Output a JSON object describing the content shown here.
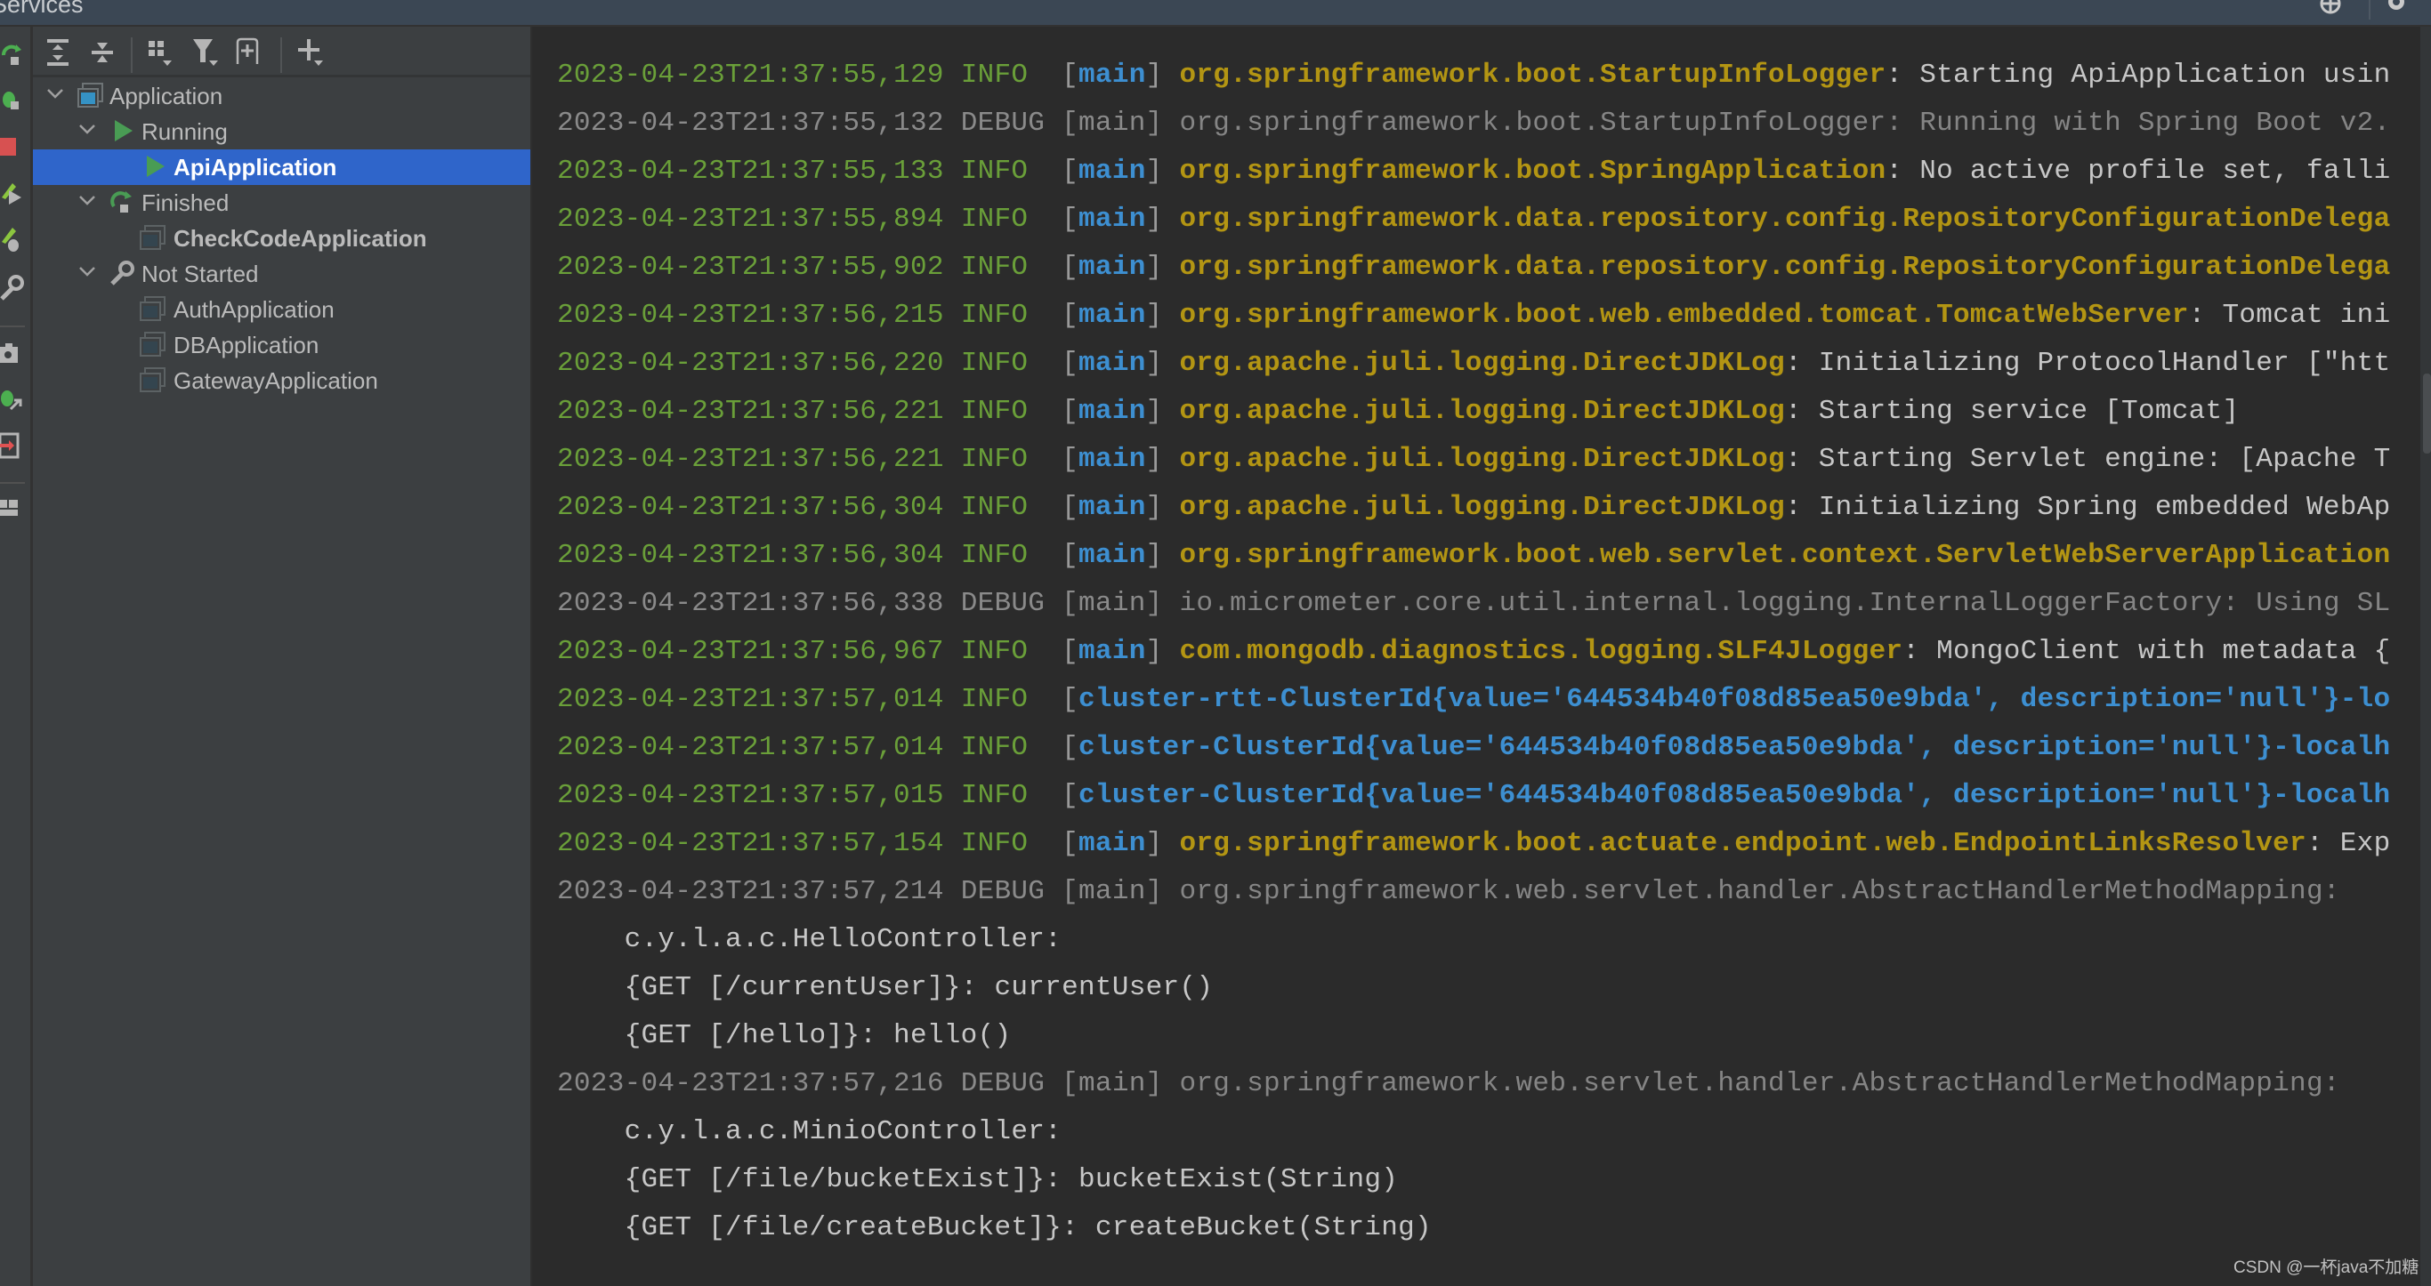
{
  "window": {
    "title": "Services"
  },
  "header_icons": [
    "globe-icon",
    "gear-icon"
  ],
  "left_strip_icons": [
    "rerun-icon",
    "debug-rerun-icon",
    "stop-icon",
    "run-boot-icon",
    "debug-boot-icon",
    "wrench-icon",
    "camera-icon",
    "attach-debugger-icon",
    "exit-icon",
    "layout-icon"
  ],
  "toolbar": {
    "buttons": [
      {
        "name": "expand-all-icon",
        "tooltip": "Expand All"
      },
      {
        "name": "collapse-all-icon",
        "tooltip": "Collapse All"
      },
      {
        "name": "group-by-icon",
        "tooltip": "Group By"
      },
      {
        "name": "filter-icon",
        "tooltip": "Filter"
      },
      {
        "name": "new-tab-icon",
        "tooltip": "Open in New Tab"
      },
      {
        "name": "add-service-icon",
        "tooltip": "Add Service"
      }
    ]
  },
  "tree": {
    "root": "Application",
    "groups": [
      {
        "label": "Running",
        "status": "running",
        "items": [
          "ApiApplication"
        ]
      },
      {
        "label": "Finished",
        "status": "finished",
        "items": [
          "CheckCodeApplication"
        ]
      },
      {
        "label": "Not Started",
        "status": "not-started",
        "items": [
          "AuthApplication",
          "DBApplication",
          "GatewayApplication"
        ]
      }
    ],
    "selected": "ApiApplication"
  },
  "console": {
    "lines": [
      {
        "ts": "2023-04-23T21:37:55,129",
        "level": "INFO ",
        "thread": "main",
        "logger": "org.springframework.boot.StartupInfoLogger",
        "msg": ": Starting ApiApplication usin",
        "kind": "info"
      },
      {
        "ts": "2023-04-23T21:37:55,132",
        "level": "DEBUG",
        "thread": "main",
        "logger": "org.springframework.boot.StartupInfoLogger",
        "msg": ": Running with Spring Boot v2.",
        "kind": "debug"
      },
      {
        "ts": "2023-04-23T21:37:55,133",
        "level": "INFO ",
        "thread": "main",
        "logger": "org.springframework.boot.SpringApplication",
        "msg": ": No active profile set, falli",
        "kind": "info"
      },
      {
        "ts": "2023-04-23T21:37:55,894",
        "level": "INFO ",
        "thread": "main",
        "logger": "org.springframework.data.repository.config.RepositoryConfigurationDelega",
        "msg": "",
        "kind": "info"
      },
      {
        "ts": "2023-04-23T21:37:55,902",
        "level": "INFO ",
        "thread": "main",
        "logger": "org.springframework.data.repository.config.RepositoryConfigurationDelega",
        "msg": "",
        "kind": "info"
      },
      {
        "ts": "2023-04-23T21:37:56,215",
        "level": "INFO ",
        "thread": "main",
        "logger": "org.springframework.boot.web.embedded.tomcat.TomcatWebServer",
        "msg": ": Tomcat ini",
        "kind": "info"
      },
      {
        "ts": "2023-04-23T21:37:56,220",
        "level": "INFO ",
        "thread": "main",
        "logger": "org.apache.juli.logging.DirectJDKLog",
        "msg": ": Initializing ProtocolHandler [\"htt",
        "kind": "info"
      },
      {
        "ts": "2023-04-23T21:37:56,221",
        "level": "INFO ",
        "thread": "main",
        "logger": "org.apache.juli.logging.DirectJDKLog",
        "msg": ": Starting service [Tomcat]",
        "kind": "info"
      },
      {
        "ts": "2023-04-23T21:37:56,221",
        "level": "INFO ",
        "thread": "main",
        "logger": "org.apache.juli.logging.DirectJDKLog",
        "msg": ": Starting Servlet engine: [Apache T",
        "kind": "info"
      },
      {
        "ts": "2023-04-23T21:37:56,304",
        "level": "INFO ",
        "thread": "main",
        "logger": "org.apache.juli.logging.DirectJDKLog",
        "msg": ": Initializing Spring embedded WebAp",
        "kind": "info"
      },
      {
        "ts": "2023-04-23T21:37:56,304",
        "level": "INFO ",
        "thread": "main",
        "logger": "org.springframework.boot.web.servlet.context.ServletWebServerApplication",
        "msg": "",
        "kind": "info"
      },
      {
        "ts": "2023-04-23T21:37:56,338",
        "level": "DEBUG",
        "thread": "main",
        "logger": "io.micrometer.core.util.internal.logging.InternalLoggerFactory",
        "msg": ": Using SL",
        "kind": "debug"
      },
      {
        "ts": "2023-04-23T21:37:56,967",
        "level": "INFO ",
        "thread": "main",
        "logger": "com.mongodb.diagnostics.logging.SLF4JLogger",
        "msg": ": MongoClient with metadata {",
        "kind": "info"
      },
      {
        "ts": "2023-04-23T21:37:57,014",
        "level": "INFO ",
        "thread": "cluster-rtt-ClusterId{value='644534b40f08d85ea50e9bda', description='null'}-lo",
        "logger": "",
        "msg": "",
        "kind": "cluster"
      },
      {
        "ts": "2023-04-23T21:37:57,014",
        "level": "INFO ",
        "thread": "cluster-ClusterId{value='644534b40f08d85ea50e9bda', description='null'}-localh",
        "logger": "",
        "msg": "",
        "kind": "cluster"
      },
      {
        "ts": "2023-04-23T21:37:57,015",
        "level": "INFO ",
        "thread": "cluster-ClusterId{value='644534b40f08d85ea50e9bda', description='null'}-localh",
        "logger": "",
        "msg": "",
        "kind": "cluster"
      },
      {
        "ts": "2023-04-23T21:37:57,154",
        "level": "INFO ",
        "thread": "main",
        "logger": "org.springframework.boot.actuate.endpoint.web.EndpointLinksResolver",
        "msg": ": Exp",
        "kind": "info"
      },
      {
        "ts": "2023-04-23T21:37:57,214",
        "level": "DEBUG",
        "thread": "main",
        "logger": "org.springframework.web.servlet.handler.AbstractHandlerMethodMapping",
        "msg": ":",
        "kind": "debug"
      },
      {
        "text": "    c.y.l.a.c.HelloController:",
        "kind": "cont"
      },
      {
        "text": "    {GET [/currentUser]}: currentUser()",
        "kind": "cont"
      },
      {
        "text": "    {GET [/hello]}: hello()",
        "kind": "cont"
      },
      {
        "ts": "2023-04-23T21:37:57,216",
        "level": "DEBUG",
        "thread": "main",
        "logger": "org.springframework.web.servlet.handler.AbstractHandlerMethodMapping",
        "msg": ":",
        "kind": "debug"
      },
      {
        "text": "    c.y.l.a.c.MinioController:",
        "kind": "cont"
      },
      {
        "text": "    {GET [/file/bucketExist]}: bucketExist(String)",
        "kind": "cont"
      },
      {
        "text": "    {GET [/file/createBucket]}: createBucket(String)",
        "kind": "cont"
      }
    ]
  },
  "colors": {
    "info": "#6a9f39",
    "debug": "#8a8a8a",
    "thread": "#3d8fd1",
    "logger": "#b39513",
    "selection": "#2f65ca"
  },
  "watermark": "CSDN @一杯java不加糖"
}
